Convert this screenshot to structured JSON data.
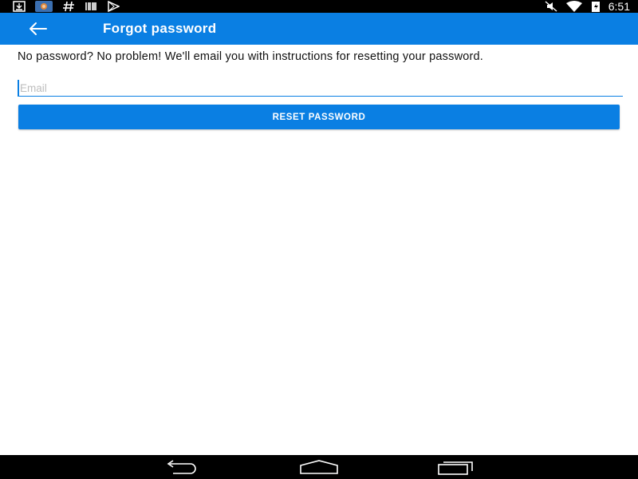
{
  "status_bar": {
    "time": "6:51",
    "left_icons": [
      "download-icon",
      "photos-icon",
      "hashtag-icon",
      "barcode-icon",
      "play-store-icon"
    ],
    "right_icons": [
      "mute-icon",
      "wifi-icon",
      "battery-charging-icon"
    ]
  },
  "app_bar": {
    "title": "Forgot password",
    "back_icon": "arrow-back-icon",
    "color": "#0a7fe3"
  },
  "form": {
    "instructions": "No password? No problem! We'll email you with instructions for resetting your password.",
    "email_placeholder": "Email",
    "email_value": "",
    "reset_label": "RESET PASSWORD"
  },
  "nav_bar": {
    "buttons": [
      "back-nav-icon",
      "home-nav-icon",
      "recents-nav-icon"
    ]
  }
}
